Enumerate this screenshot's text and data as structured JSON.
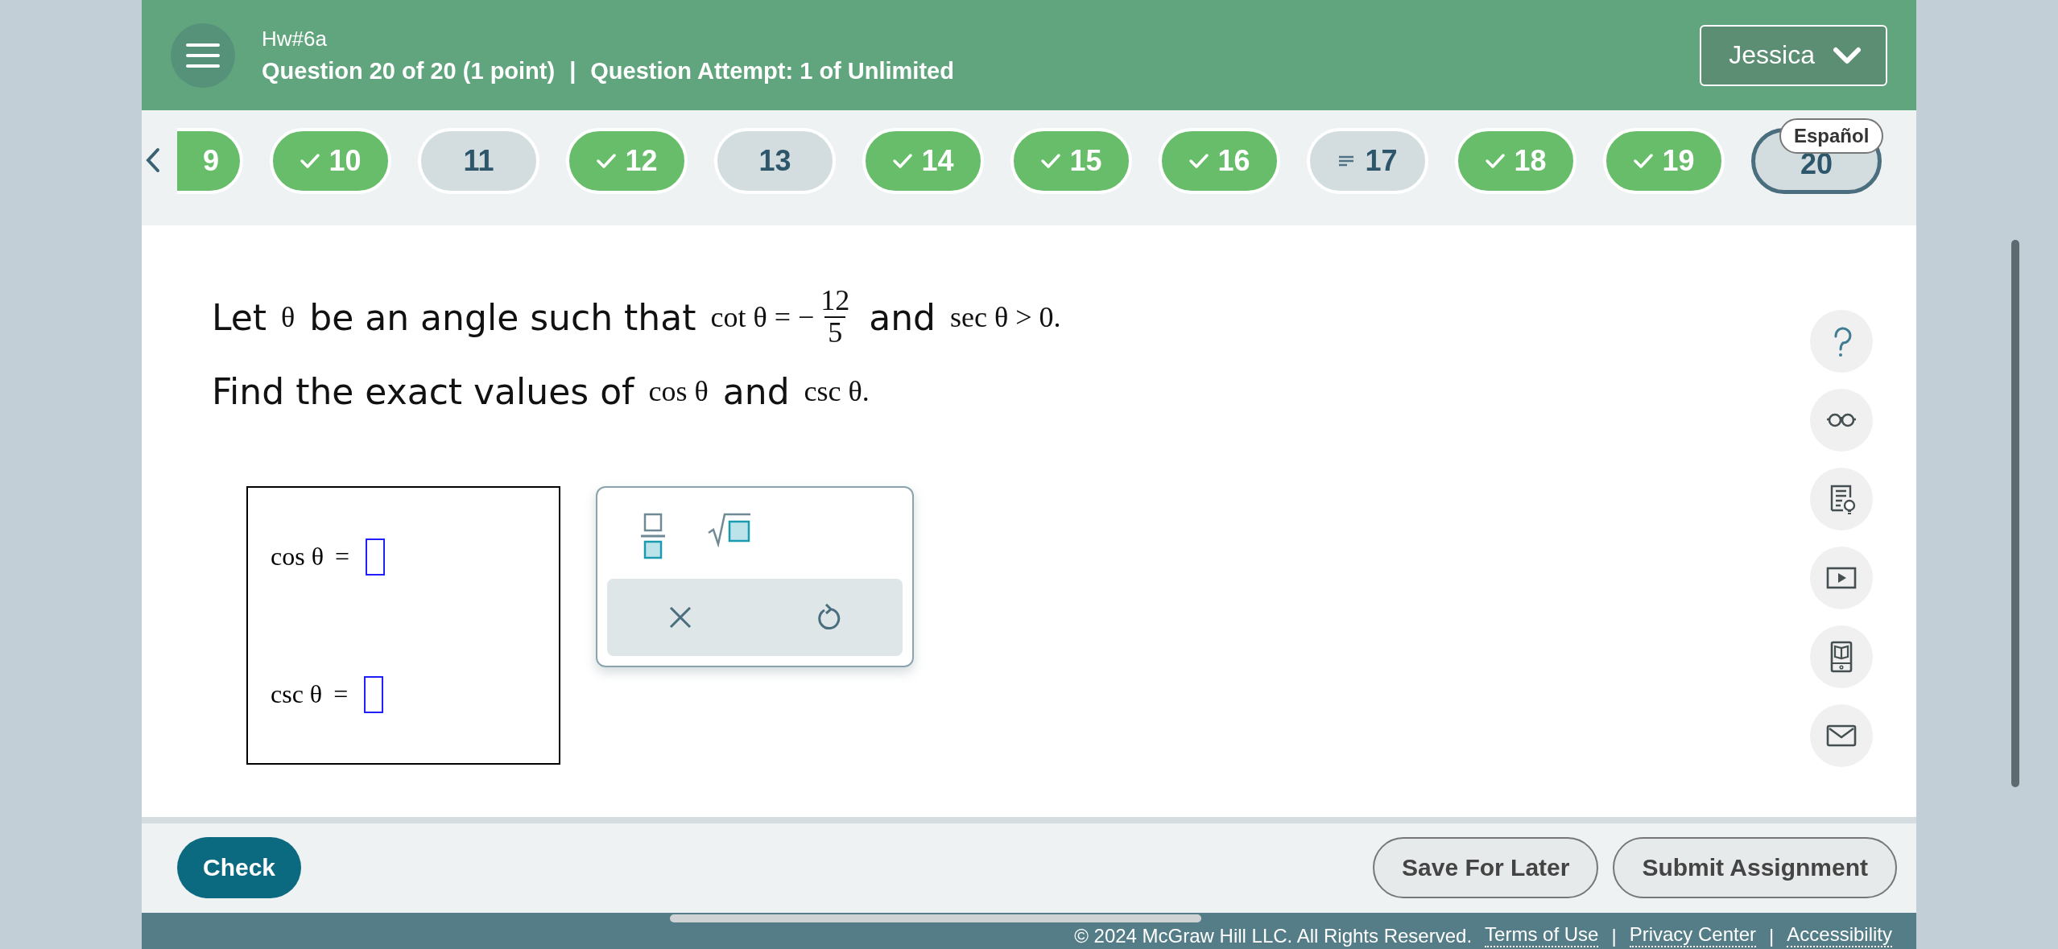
{
  "header": {
    "assignment": "Hw#6a",
    "question_info": "Question 20 of 20 (1 point)",
    "separator": "|",
    "attempt_info": "Question Attempt: 1 of Unlimited",
    "user_menu": "Jessica"
  },
  "question_nav": {
    "items": [
      {
        "label": "9",
        "kind": "done",
        "selected": false
      },
      {
        "label": "10",
        "kind": "done",
        "selected": false
      },
      {
        "label": "11",
        "kind": "unanswered",
        "selected": false
      },
      {
        "label": "12",
        "kind": "done",
        "selected": false
      },
      {
        "label": "13",
        "kind": "unanswered",
        "selected": false
      },
      {
        "label": "14",
        "kind": "done",
        "selected": false
      },
      {
        "label": "15",
        "kind": "done",
        "selected": false
      },
      {
        "label": "16",
        "kind": "done",
        "selected": false
      },
      {
        "label": "17",
        "kind": "partial",
        "selected": false
      },
      {
        "label": "18",
        "kind": "done",
        "selected": false
      },
      {
        "label": "19",
        "kind": "done",
        "selected": false
      },
      {
        "label": "20",
        "kind": "unanswered",
        "selected": true
      }
    ],
    "language_badge": "Español"
  },
  "question": {
    "lines": [
      [
        {
          "kind": "text",
          "text": "Let "
        },
        {
          "kind": "math",
          "text": "θ"
        },
        {
          "kind": "text",
          "text": " be an angle such that "
        },
        {
          "kind": "math",
          "text": "cot θ = −"
        },
        {
          "kind": "fraction",
          "numerator": "12",
          "denominator": "5"
        },
        {
          "kind": "text",
          "text": " and "
        },
        {
          "kind": "math",
          "text": "sec θ > 0."
        }
      ],
      [
        {
          "kind": "text",
          "text": "Find the exact values of "
        },
        {
          "kind": "math",
          "text": "cos θ"
        },
        {
          "kind": "text",
          "text": " and "
        },
        {
          "kind": "math",
          "text": "csc θ."
        }
      ]
    ]
  },
  "answers": [
    {
      "label": "cos θ",
      "sign": "="
    },
    {
      "label": "csc θ",
      "sign": "="
    }
  ],
  "actions": {
    "check": "Check",
    "save": "Save For Later",
    "submit": "Submit Assignment"
  },
  "footer": {
    "copyright": "© 2024 McGraw Hill LLC. All Rights Reserved.",
    "links": [
      {
        "label": "Terms of Use"
      },
      {
        "separator": "|",
        "label": "Privacy Center"
      },
      {
        "separator": "|",
        "label": "Accessibility"
      }
    ]
  }
}
